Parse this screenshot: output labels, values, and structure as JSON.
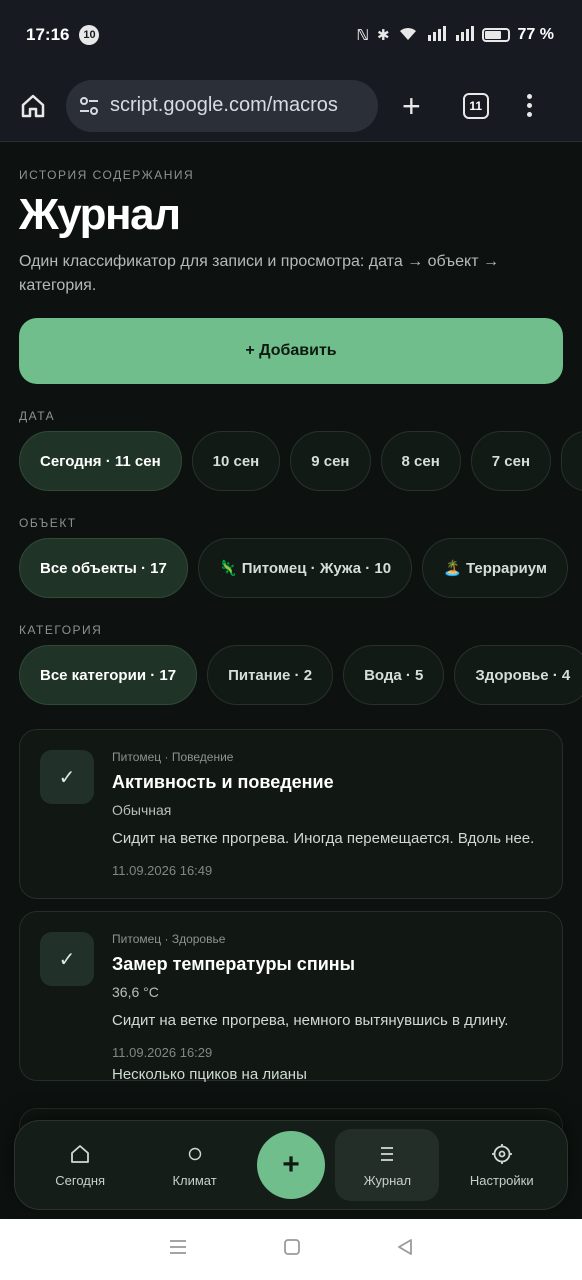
{
  "status_bar": {
    "time": "17:16",
    "notification_count": "10",
    "battery": "77 %",
    "battery_level": 0.77
  },
  "browser": {
    "url": "script.google.com/macros",
    "tab_count": "11"
  },
  "header": {
    "eyebrow": "ИСТОРИЯ СОДЕРЖАНИЯ",
    "title": "Журнал",
    "subtitle": "Один классификатор для записи и просмотра: дата → объект → категория."
  },
  "add_button": {
    "label": "+ Добавить"
  },
  "filters": {
    "date": {
      "label": "ДАТА",
      "chips": [
        "Сегодня · 11 сен",
        "10 сен",
        "9 сен",
        "8 сен",
        "7 сен",
        "6"
      ]
    },
    "object": {
      "label": "ОБЪЕКТ",
      "chips": [
        "Все объекты · 17",
        "🦎 Питомец · Жужа · 10",
        "🏝️ Террариум"
      ]
    },
    "category": {
      "label": "КАТЕГОРИЯ",
      "chips": [
        "Все категории · 17",
        "Питание · 2",
        "Вода · 5",
        "Здоровье · 4"
      ]
    }
  },
  "entries": [
    {
      "meta": "Питомец · Поведение",
      "title": "Активность и поведение",
      "value": "Обычная",
      "text": "Сидит на ветке прогрева. Иногда перемещается. Вдоль нее.",
      "date": "11.09.2026 16:49",
      "check": "✓"
    },
    {
      "meta": "Питомец · Здоровье",
      "title": "Замер температуры спины",
      "value": "36,6 °C",
      "text": "Сидит на ветке прогрева, немного вытянувшись в длину.",
      "date": "11.09.2026 16:29",
      "check": "✓"
    }
  ],
  "peek_text": "Несколько пциков на лианы",
  "bottom_nav": {
    "items": [
      {
        "label": "Сегодня",
        "icon": "home-icon"
      },
      {
        "label": "Климат",
        "icon": "circle-icon"
      },
      {
        "label": "+",
        "icon": "plus-icon"
      },
      {
        "label": "Журнал",
        "icon": "list-icon"
      },
      {
        "label": "Настройки",
        "icon": "gear-icon"
      }
    ]
  },
  "colors": {
    "accent": "#6fbe8b",
    "background": "#0d1210",
    "chip_active": "#1f3326"
  }
}
